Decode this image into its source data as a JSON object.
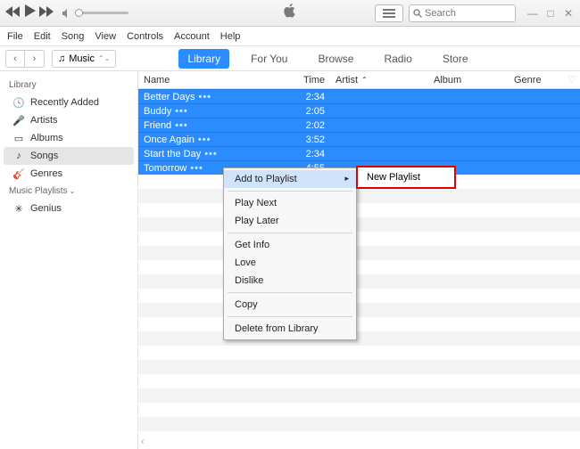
{
  "search_placeholder": "Search",
  "menubar": [
    "File",
    "Edit",
    "Song",
    "View",
    "Controls",
    "Account",
    "Help"
  ],
  "source": "Music",
  "tabs": [
    {
      "label": "Library",
      "active": true
    },
    {
      "label": "For You",
      "active": false
    },
    {
      "label": "Browse",
      "active": false
    },
    {
      "label": "Radio",
      "active": false
    },
    {
      "label": "Store",
      "active": false
    }
  ],
  "sidebar": {
    "library_header": "Library",
    "items": [
      {
        "label": "Recently Added"
      },
      {
        "label": "Artists"
      },
      {
        "label": "Albums"
      },
      {
        "label": "Songs"
      },
      {
        "label": "Genres"
      }
    ],
    "playlists_header": "Music Playlists",
    "playlists": [
      {
        "label": "Genius"
      }
    ]
  },
  "columns": {
    "name": "Name",
    "time": "Time",
    "artist": "Artist",
    "album": "Album",
    "genre": "Genre"
  },
  "songs": [
    {
      "name": "Better Days",
      "time": "2:34"
    },
    {
      "name": "Buddy",
      "time": "2:05"
    },
    {
      "name": "Friend",
      "time": "2:02"
    },
    {
      "name": "Once Again",
      "time": "3:52"
    },
    {
      "name": "Start the Day",
      "time": "2:34"
    },
    {
      "name": "Tomorrow",
      "time": "4:55"
    }
  ],
  "context_menu": {
    "add_to_playlist": "Add to Playlist",
    "play_next": "Play Next",
    "play_later": "Play Later",
    "get_info": "Get Info",
    "love": "Love",
    "dislike": "Dislike",
    "copy": "Copy",
    "delete": "Delete from Library"
  },
  "submenu": {
    "new_playlist": "New Playlist"
  }
}
